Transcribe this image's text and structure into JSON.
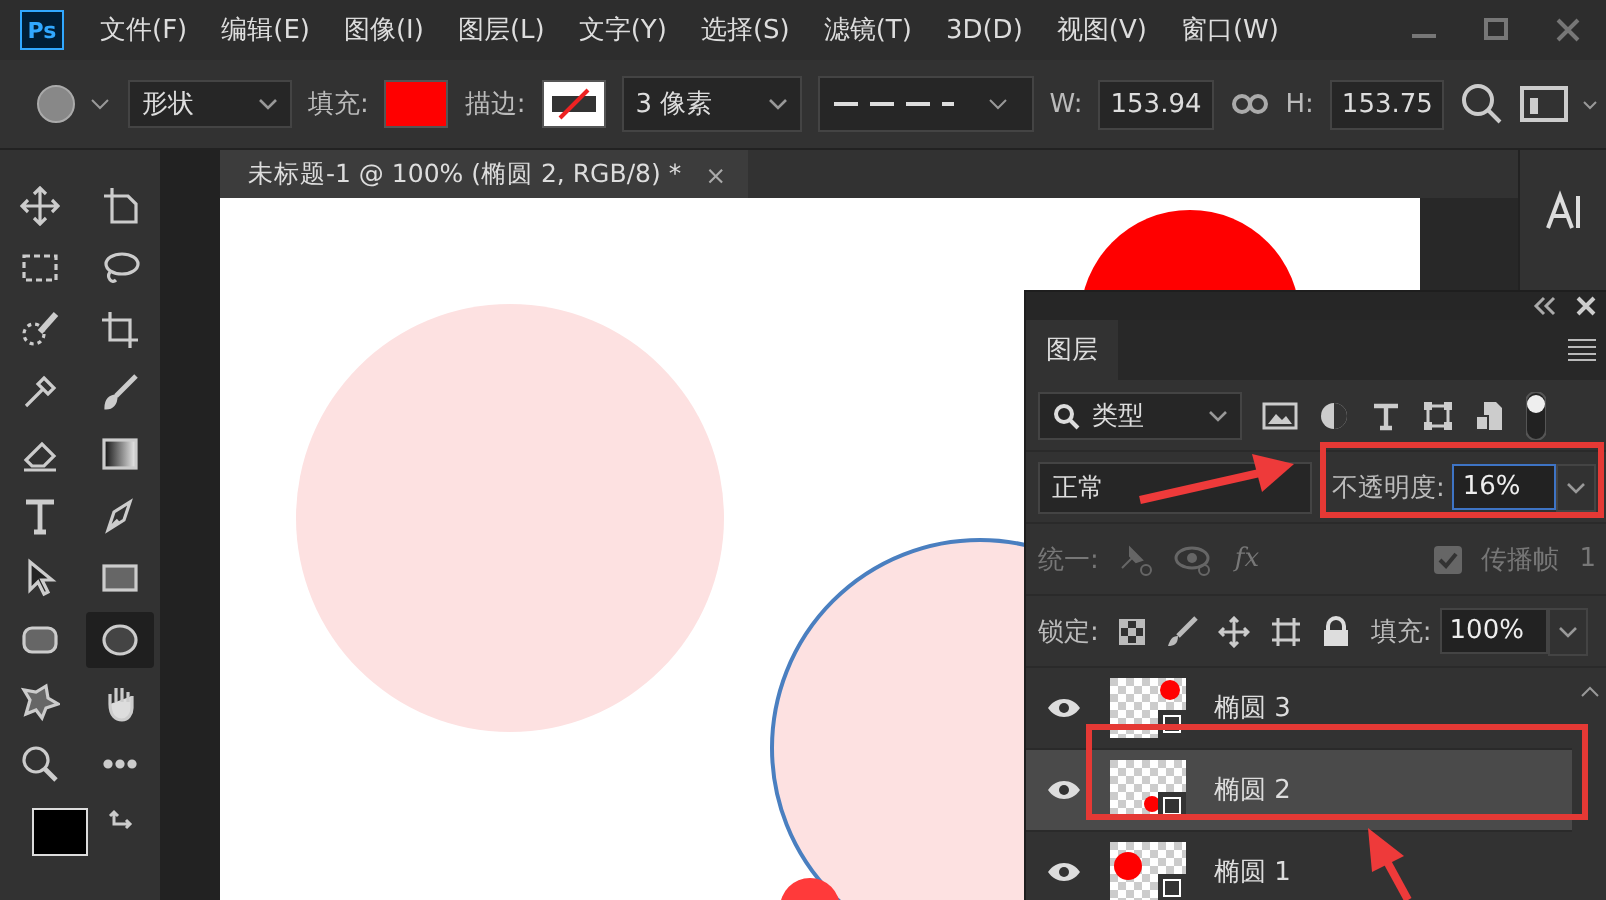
{
  "app_icon": "Ps",
  "menu": [
    "文件(F)",
    "编辑(E)",
    "图像(I)",
    "图层(L)",
    "文字(Y)",
    "选择(S)",
    "滤镜(T)",
    "3D(D)",
    "视图(V)",
    "窗口(W)"
  ],
  "options_bar": {
    "mode": "形状",
    "fill_label": "填充:",
    "stroke_label": "描边:",
    "stroke_width": "3 像素",
    "w_label": "W:",
    "w_value": "153.94",
    "h_label": "H:",
    "h_value": "153.75"
  },
  "document_tab": {
    "title": "未标题-1 @ 100% (椭圆 2, RGB/8) *",
    "close": "×"
  },
  "tools": [
    {
      "kind": "move",
      "selected": false
    },
    {
      "kind": "artboard",
      "selected": false
    },
    {
      "kind": "marquee",
      "selected": false
    },
    {
      "kind": "lasso",
      "selected": false
    },
    {
      "kind": "quickselect",
      "selected": false
    },
    {
      "kind": "crop",
      "selected": false
    },
    {
      "kind": "eyedropper",
      "selected": false
    },
    {
      "kind": "brush",
      "selected": false
    },
    {
      "kind": "eraser",
      "selected": false
    },
    {
      "kind": "gradient",
      "selected": false
    },
    {
      "kind": "type",
      "selected": false
    },
    {
      "kind": "pen",
      "selected": false
    },
    {
      "kind": "pathselect",
      "selected": false
    },
    {
      "kind": "rectangle",
      "selected": false
    },
    {
      "kind": "roundrect",
      "selected": false
    },
    {
      "kind": "ellipse",
      "selected": true
    },
    {
      "kind": "shape",
      "selected": false
    },
    {
      "kind": "hand",
      "selected": false
    },
    {
      "kind": "zoom",
      "selected": false
    },
    {
      "kind": "more",
      "selected": false
    }
  ],
  "layers_panel": {
    "tab": "图层",
    "filter": "类型",
    "blend_mode": "正常",
    "opacity_label": "不透明度:",
    "opacity_value": "16%",
    "unify_label": "统一:",
    "unify_style": "fx",
    "propagate": {
      "label": "传播帧",
      "checked": true
    },
    "frame_number": "1",
    "lock_label": "锁定:",
    "fill_label": "填充:",
    "fill_value": "100%",
    "layers": [
      {
        "name": "椭圆 3",
        "visible": true,
        "selected": false
      },
      {
        "name": "椭圆 2",
        "visible": true,
        "selected": true
      },
      {
        "name": "椭圆 1",
        "visible": true,
        "selected": false
      }
    ]
  }
}
